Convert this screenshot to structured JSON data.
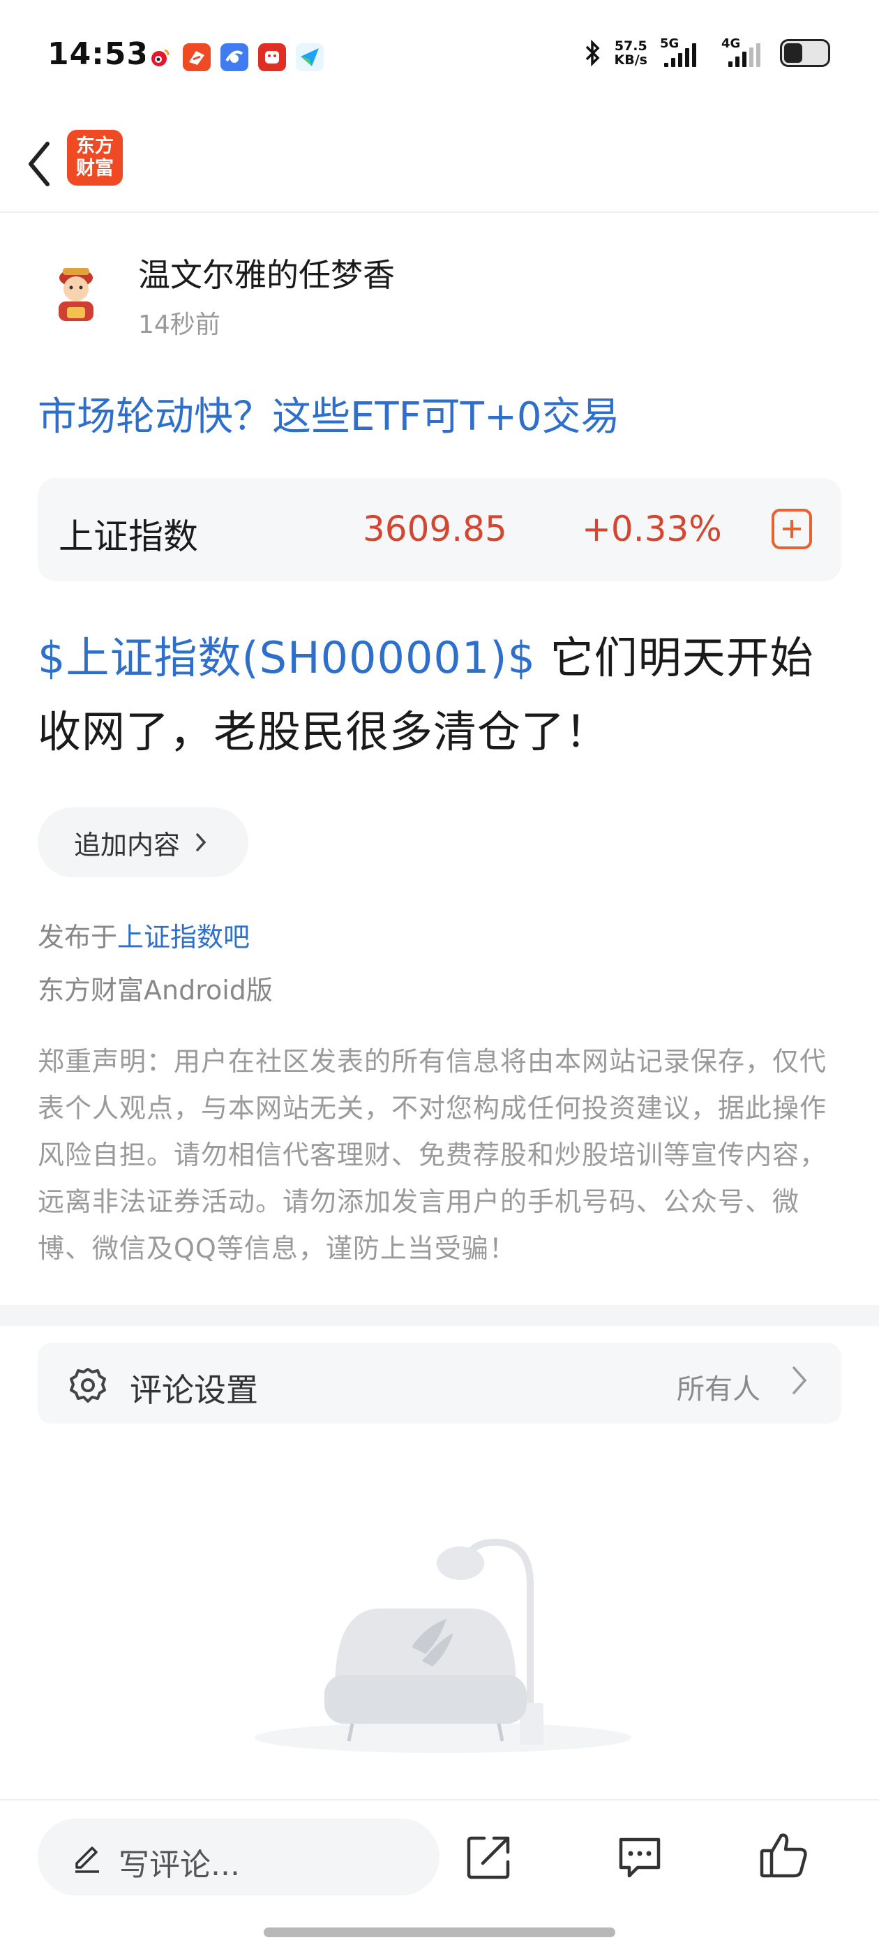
{
  "status_bar": {
    "time": "14:53",
    "net_speed_value": "57.5",
    "net_speed_unit": "KB/s",
    "signal_1": "5G",
    "signal_2": "4G",
    "battery_level": 0.35
  },
  "header": {
    "logo_line1": "东方",
    "logo_line2": "财富"
  },
  "author": {
    "name": "温文尔雅的任梦香",
    "time": "14秒前"
  },
  "post": {
    "title": "市场轮动快？这些ETF可T+0交易",
    "stock_link": "$上证指数(SH000001)$",
    "body_text": "  它们明天开始收网了，老股民很多清仓了！"
  },
  "index_card": {
    "name": "上证指数",
    "price": "3609.85",
    "change": "+0.33%"
  },
  "append_button": "追加内容",
  "publish": {
    "prefix": "发布于",
    "bar_name": "上证指数吧",
    "client": "东方财富Android版"
  },
  "disclaimer": "郑重声明：用户在社区发表的所有信息将由本网站记录保存，仅代表个人观点，与本网站无关，不对您构成任何投资建议，据此操作风险自担。请勿相信代客理财、免费荐股和炒股培训等宣传内容，远离非法证券活动。请勿添加发言用户的手机号码、公众号、微博、微信及QQ等信息，谨防上当受骗！",
  "comment_settings": {
    "label": "评论设置",
    "value": "所有人"
  },
  "bottom_bar": {
    "comment_placeholder": "写评论..."
  },
  "icons": {
    "back": "chevron-left-icon",
    "gear": "gear-icon",
    "pencil": "pencil-icon",
    "share": "share-icon",
    "reply": "comment-bubble-icon",
    "like": "thumbs-up-icon"
  },
  "colors": {
    "link_blue": "#2d6fca",
    "price_red": "#d4462f",
    "brand_orange": "#f04a24"
  }
}
